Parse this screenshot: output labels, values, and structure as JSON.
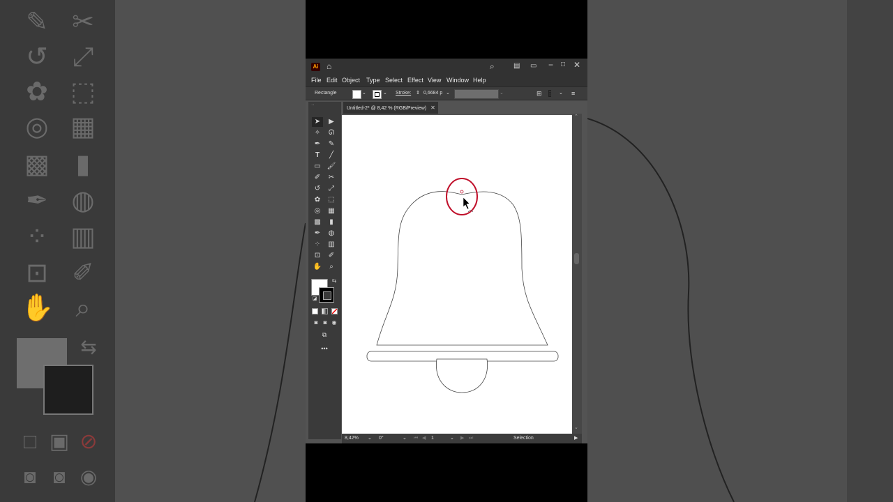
{
  "app": {
    "logo_text": "Ai",
    "menu": [
      "File",
      "Edit",
      "Object",
      "Type",
      "Select",
      "Effect",
      "View",
      "Window",
      "Help"
    ]
  },
  "controlbar": {
    "tool_name": "Rectangle",
    "stroke_label": "Stroke:",
    "stroke_value": "0,6684 p"
  },
  "document": {
    "tab_title": "Untitled-2* @ 8,42 % (RGB/Preview)",
    "close_glyph": "✕"
  },
  "status": {
    "zoom": "8,42%",
    "rotation": "0°",
    "artboard_number": "1",
    "current_tool": "Selection"
  },
  "colors": {
    "accent_selection": "#c0102b",
    "ai_brand": "#ff9a00",
    "panel_bg": "#535353",
    "chrome_bg": "#323232"
  },
  "icons": {
    "home": "home-icon",
    "search": "search-icon",
    "arrange": "arrange-documents-icon",
    "workspace": "workspace-icon",
    "minimize": "minimize-icon",
    "maximize": "maximize-icon",
    "close": "close-icon"
  }
}
